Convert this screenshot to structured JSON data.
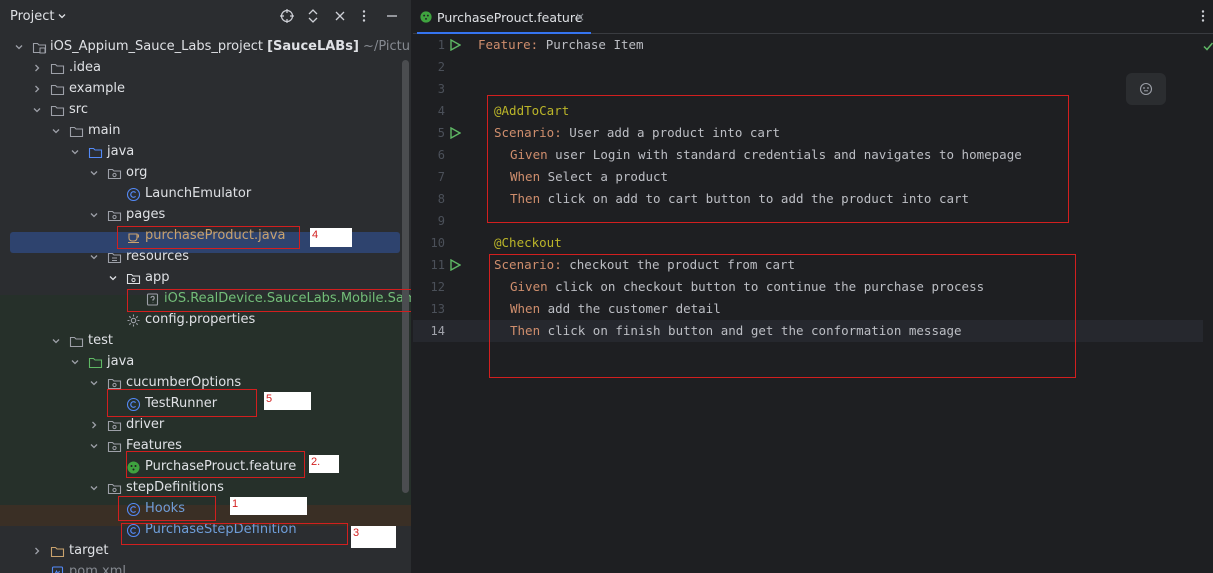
{
  "project_panel": {
    "title": "Project",
    "tree": [
      {
        "label": "iOS_Appium_Sauce_Labs_project",
        "extra_bold": "[SauceLABs]",
        "extra_dim": "~/Pictures/"
      },
      {
        "label": ".idea"
      },
      {
        "label": "example"
      },
      {
        "label": "src"
      },
      {
        "label": "main"
      },
      {
        "label": "java"
      },
      {
        "label": "org"
      },
      {
        "label": "LaunchEmulator"
      },
      {
        "label": "pages"
      },
      {
        "label": "purchaseProduct.java"
      },
      {
        "label": "resources"
      },
      {
        "label": "app"
      },
      {
        "label": "iOS.RealDevice.SauceLabs.Mobile.Samp"
      },
      {
        "label": "config.properties"
      },
      {
        "label": "test"
      },
      {
        "label": "java"
      },
      {
        "label": "cucumberOptions"
      },
      {
        "label": "TestRunner"
      },
      {
        "label": "driver"
      },
      {
        "label": "Features"
      },
      {
        "label": "PurchaseProuct.feature"
      },
      {
        "label": "stepDefinitions"
      },
      {
        "label": "Hooks"
      },
      {
        "label": "PurchaseStepDefinition"
      },
      {
        "label": "target"
      },
      {
        "label": "pom.xml"
      }
    ],
    "annotations": [
      "4",
      "5",
      "2.",
      "1",
      "3"
    ]
  },
  "editor": {
    "tab_label": "PurchaseProuct.feature",
    "tab_close": "×",
    "line_numbers": [
      "1",
      "2",
      "3",
      "4",
      "5",
      "6",
      "7",
      "8",
      "9",
      "10",
      "11",
      "12",
      "13",
      "14"
    ],
    "lines": {
      "l1_kw": "Feature:",
      "l1_txt": " Purchase Item",
      "l4_tag": "@AddToCart",
      "l5_kw": "Scenario:",
      "l5_txt": " User add a product into cart",
      "l6_kw": "Given",
      "l6_txt": " user Login with standard credentials and navigates to homepage",
      "l7_kw": "When",
      "l7_txt": " Select a product",
      "l8_kw": "Then",
      "l8_txt": " click on add to cart button to add the product into cart",
      "l10_tag": "@Checkout",
      "l11_kw": "Scenario:",
      "l11_txt": " checkout the product from cart",
      "l12_kw": "Given",
      "l12_txt": " click on checkout button to continue the purchase process",
      "l13_kw": "When",
      "l13_txt": " add the customer detail",
      "l14_kw": "Then",
      "l14_txt": " click on finish button and get the conformation message"
    }
  },
  "colors": {
    "keyword": "#cf8e6d",
    "tag": "#bbb529",
    "annotation_box": "#d21f1f",
    "selection": "#2e436e"
  }
}
